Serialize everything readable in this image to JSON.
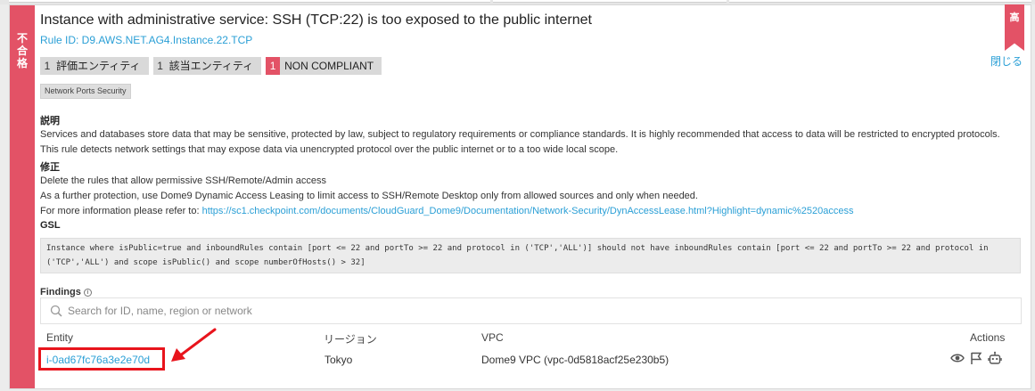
{
  "status_label": "不合格",
  "severity_label": "高",
  "close_label": "閉じる",
  "title": "Instance with administrative service: SSH (TCP:22) is too exposed to the public internet",
  "rule_id": "Rule ID: D9.AWS.NET.AG4.Instance.22.TCP",
  "counters": [
    {
      "value": "1",
      "label": "評価エンティティ"
    },
    {
      "value": "1",
      "label": "該当エンティティ"
    },
    {
      "value": "1",
      "label": "NON COMPLIANT"
    }
  ],
  "tag": "Network Ports Security",
  "description": {
    "heading": "説明",
    "text": "Services and databases store data that may be sensitive, protected by law, subject to regulatory requirements or compliance standards. It is highly recommended that access to data will be restricted to encrypted protocols. This rule detects network settings that may expose data via unencrypted protocol over the public internet or to a too wide local scope."
  },
  "remediation": {
    "heading": "修正",
    "line1": "Delete the rules that allow permissive SSH/Remote/Admin access",
    "line2": "As a further protection, use Dome9 Dynamic Access Leasing to limit access to SSH/Remote Desktop only from allowed sources and only when needed.",
    "line3_prefix": "For more information please refer to: ",
    "link": "https://sc1.checkpoint.com/documents/CloudGuard_Dome9/Documentation/Network-Security/DynAccessLease.html?Highlight=dynamic%2520access"
  },
  "gsl": {
    "heading": "GSL",
    "code": "Instance where isPublic=true and inboundRules contain [port <= 22 and portTo >= 22 and protocol in ('TCP','ALL')] should not have inboundRules contain [port <= 22 and portTo >= 22 and protocol in ('TCP','ALL') and scope isPublic() and scope numberOfHosts() > 32]"
  },
  "findings": {
    "heading": "Findings",
    "info_glyph": "i",
    "search_placeholder": "Search for ID, name, region or network",
    "columns": {
      "entity": "Entity",
      "region": "リージョン",
      "vpc": "VPC",
      "actions": "Actions"
    },
    "rows": [
      {
        "entity": "i-0ad67fc76a3e2e70d",
        "region": "Tokyo",
        "vpc": "Dome9 VPC (vpc-0d5818acf25e230b5)"
      }
    ]
  },
  "colors": {
    "status_red": "#e35266",
    "link_blue": "#2a9fd6",
    "annotation_red": "#e8141c"
  }
}
